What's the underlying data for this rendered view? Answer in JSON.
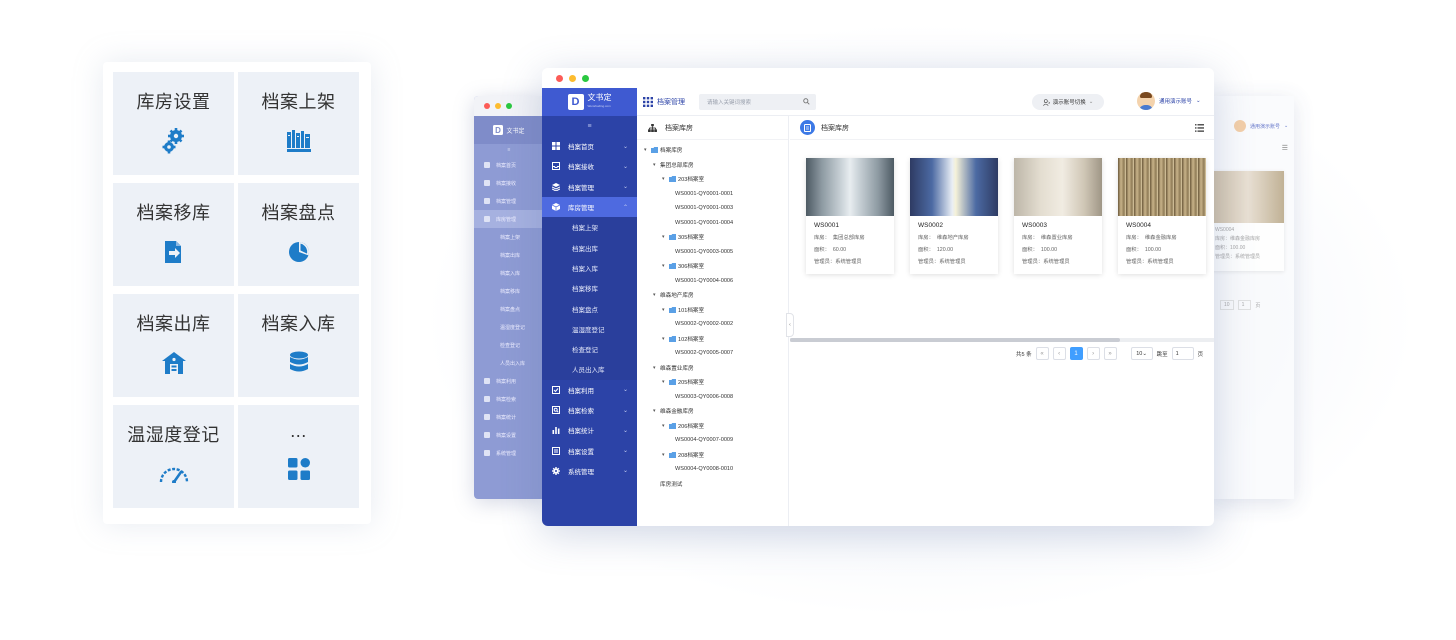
{
  "colors": {
    "sidebar_bg": "#2c43a7",
    "sidebar_active": "#4e6ae0",
    "accent_blue": "#3c79e6",
    "feature_icon": "#1e7cc8",
    "tile_bg": "#edf1f7",
    "pager_active": "#409eff"
  },
  "features": [
    {
      "label": "库房设置",
      "icon": "gears-icon"
    },
    {
      "label": "档案上架",
      "icon": "books-icon"
    },
    {
      "label": "档案移库",
      "icon": "file-transfer-icon"
    },
    {
      "label": "档案盘点",
      "icon": "pie-chart-icon"
    },
    {
      "label": "档案出库",
      "icon": "warehouse-icon"
    },
    {
      "label": "档案入库",
      "icon": "database-icon"
    },
    {
      "label": "温湿度登记",
      "icon": "gauge-icon"
    },
    {
      "label": "...",
      "icon": "grid-apps-icon"
    }
  ],
  "app": {
    "logo_text": "文书定",
    "logo_sub": "Wenshuding.com",
    "top_title": "档案管理",
    "search_placeholder": "请输入关键词搜索",
    "account_switch": "演示账号切换",
    "user_name": "通用演示账号"
  },
  "sidebar": {
    "items": [
      {
        "label": "档案首页",
        "icon": "dashboard-icon"
      },
      {
        "label": "档案接收",
        "icon": "inbox-icon"
      },
      {
        "label": "档案管理",
        "icon": "layers-icon"
      },
      {
        "label": "库房管理",
        "icon": "cube-icon",
        "active": true
      }
    ],
    "subitems": [
      "档案上架",
      "档案出库",
      "档案入库",
      "档案移库",
      "档案盘点",
      "温湿度登记",
      "检查登记",
      "人员出入库"
    ],
    "items_after": [
      {
        "label": "档案利用",
        "icon": "checklist-icon"
      },
      {
        "label": "档案检索",
        "icon": "search-box-icon"
      },
      {
        "label": "档案统计",
        "icon": "bar-chart-icon"
      },
      {
        "label": "档案设置",
        "icon": "settings-panel-icon"
      },
      {
        "label": "系统管理",
        "icon": "gear-icon"
      }
    ]
  },
  "tree": {
    "header": "档案库房",
    "rows": [
      {
        "text": "档案库房",
        "level": 0,
        "arrow": "▾",
        "icon": true
      },
      {
        "text": "集团总部库房",
        "level": 1,
        "arrow": "▾"
      },
      {
        "text": "203档案室",
        "level": 2,
        "arrow": "▾",
        "icon": true
      },
      {
        "text": "WS0001-QY0001-0001",
        "level": 3
      },
      {
        "text": "WS0001-QY0001-0003",
        "level": 3
      },
      {
        "text": "WS0001-QY0001-0004",
        "level": 3
      },
      {
        "text": "305档案室",
        "level": 2,
        "arrow": "▾",
        "icon": true
      },
      {
        "text": "WS0001-QY0003-0005",
        "level": 3
      },
      {
        "text": "306档案室",
        "level": 2,
        "arrow": "▾",
        "icon": true
      },
      {
        "text": "WS0001-QY0004-0006",
        "level": 3
      },
      {
        "text": "维森地产库房",
        "level": 1,
        "arrow": "▾"
      },
      {
        "text": "101档案室",
        "level": 2,
        "arrow": "▾",
        "icon": true
      },
      {
        "text": "WS0002-QY0002-0002",
        "level": 3
      },
      {
        "text": "102档案室",
        "level": 2,
        "arrow": "▾",
        "icon": true
      },
      {
        "text": "WS0002-QY0005-0007",
        "level": 3
      },
      {
        "text": "维森置业库房",
        "level": 1,
        "arrow": "▾"
      },
      {
        "text": "205档案室",
        "level": 2,
        "arrow": "▾",
        "icon": true
      },
      {
        "text": "WS0003-QY0006-0008",
        "level": 3
      },
      {
        "text": "维森金融库房",
        "level": 1,
        "arrow": "▾"
      },
      {
        "text": "206档案室",
        "level": 2,
        "arrow": "▾",
        "icon": true
      },
      {
        "text": "WS0004-QY0007-0009",
        "level": 3
      },
      {
        "text": "208档案室",
        "level": 2,
        "arrow": "▾",
        "icon": true
      },
      {
        "text": "WS0004-QY0008-0010",
        "level": 3
      },
      {
        "text": "库房测试",
        "level": 1
      }
    ]
  },
  "content": {
    "header": "档案库房",
    "cards": [
      {
        "code": "WS0001",
        "room_label": "库房：",
        "room": "集团总部库房",
        "area_label": "面积：",
        "area": "60.00",
        "manager_label": "管理员：",
        "manager": "系统管理员",
        "photo": "corridor"
      },
      {
        "code": "WS0002",
        "room_label": "库房：",
        "room": "维森地产库房",
        "area_label": "面积：",
        "area": "120.00",
        "manager_label": "管理员：",
        "manager": "系统管理员",
        "photo": "shelves-hall"
      },
      {
        "code": "WS0003",
        "room_label": "库房：",
        "room": "维森置业库房",
        "area_label": "面积：",
        "area": "100.00",
        "manager_label": "管理员：",
        "manager": "系统管理员",
        "photo": "mobile-racks"
      },
      {
        "code": "WS0004",
        "room_label": "库房：",
        "room": "维森金融库房",
        "area_label": "面积：",
        "area": "100.00",
        "manager_label": "管理员：",
        "manager": "系统管理员",
        "photo": "binders"
      }
    ],
    "pager": {
      "total": "共5 条",
      "current": "1",
      "size": "10",
      "jump_label": "跳至",
      "jump_value": "1",
      "page_suffix": "页"
    }
  },
  "bg_right": {
    "user_name": "通用演示账号",
    "card_code": "WS0004",
    "card_room": "库房：维森金融库房",
    "card_area": "面积：100.00",
    "card_manager": "管理员：系统管理员",
    "pager_size": "10",
    "pager_jump": "1",
    "page_suffix": "页"
  },
  "bg_left": {
    "logo_text": "文书定",
    "items": [
      "档案首页",
      "档案接收",
      "档案管理",
      "库房管理",
      "档案上架",
      "档案出库",
      "档案入库",
      "档案移库",
      "档案盘点",
      "温湿度登记",
      "检查登记",
      "人员出入库",
      "档案利用",
      "档案检索",
      "档案统计",
      "档案设置",
      "系统管理"
    ]
  }
}
